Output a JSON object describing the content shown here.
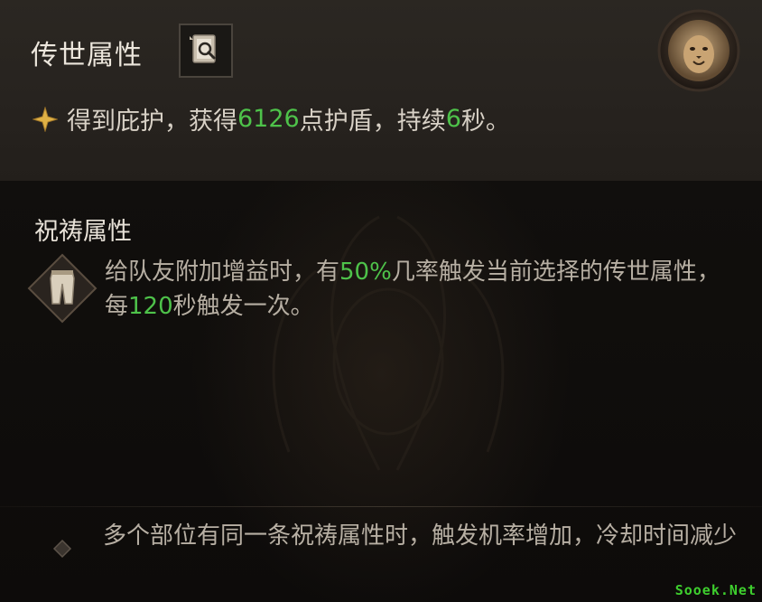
{
  "legendary": {
    "title": "传世属性",
    "effect_prefix": "得到庇护，获得",
    "shield_value": "6126",
    "effect_mid": "点护盾，持续",
    "duration_value": "6",
    "effect_suffix": "秒。"
  },
  "prayer": {
    "title": "祝祷属性",
    "text_1": "给队友附加增益时，有",
    "chance_value": "50%",
    "text_2": "几率触发当前选择的传世属性，每",
    "cooldown_value": "120",
    "text_3": "秒触发一次。"
  },
  "note": {
    "text": "多个部位有同一条祝祷属性时，触发机率增加，冷却时间减少"
  },
  "watermark": "Sooek.Net",
  "colors": {
    "highlight_green": "#4ec24a",
    "title_text": "#ece6dc",
    "body_text": "#b7afa3",
    "gold": "#d4a43a"
  },
  "icons": {
    "codex": "codex-search-icon",
    "crest": "lion-crest-icon",
    "bullet": "gold-star-icon",
    "item": "pants-icon",
    "note_bullet": "diamond-bullet-icon"
  }
}
